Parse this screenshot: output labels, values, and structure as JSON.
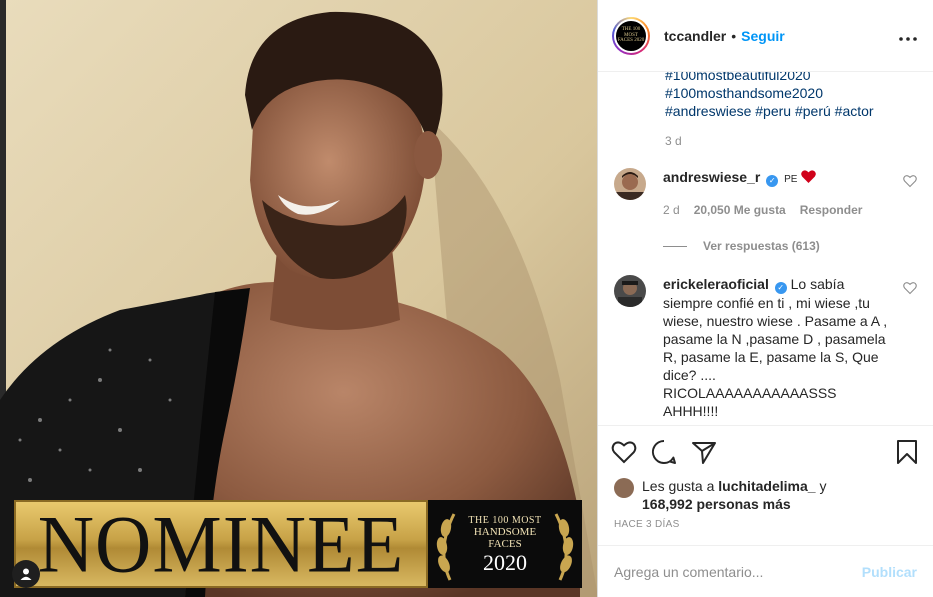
{
  "author": {
    "username": "tccandler",
    "dot": "•",
    "follow_label": "Seguir",
    "avatar_text": "THE 100 MOST FACES 2020"
  },
  "caption": {
    "hashtags": [
      "#100mostbeautiful2020",
      "#100mosthandsome2020",
      "#andreswiese #peru #perú #actor"
    ],
    "time": "3 d"
  },
  "comments": [
    {
      "username": "andreswiese_r",
      "text": "PE",
      "emoji": "heart",
      "time": "2 d",
      "likes": "20,050 Me gusta",
      "reply_label": "Responder",
      "view_replies": "Ver respuestas (613)"
    },
    {
      "username": "erickeleraoficial",
      "text": "Lo sabía siempre confié en ti , mi wiese ,tu wiese, nuestro wiese . Pasame a A , pasame la N ,pasame D , pasamela R, pasame la E, pasame la S, Que dice? .... RICOLAAAAAAAAAAASSS AHHH!!!!"
    }
  ],
  "banner": {
    "title": "NOMINEE",
    "seal_line1": "THE 100 MOST",
    "seal_line2": "HANDSOME",
    "seal_line3": "FACES",
    "seal_year": "2020"
  },
  "likes": {
    "prefix": "Les gusta a",
    "user": "luchitadelima_",
    "joiner": "y",
    "count": "168,992 personas más"
  },
  "time_ago": "HACE 3 DÍAS",
  "comment_box": {
    "placeholder": "Agrega un comentario...",
    "publish_label": "Publicar"
  },
  "colors": {
    "link": "#00376b",
    "follow": "#0095f6",
    "verified": "#3897f0",
    "publish_disabled": "#b2dffc",
    "muted": "#8e8e8e"
  },
  "icons": [
    "heart-icon",
    "comment-icon",
    "share-icon",
    "bookmark-icon",
    "more-icon",
    "verified-icon",
    "user-tag-icon"
  ]
}
